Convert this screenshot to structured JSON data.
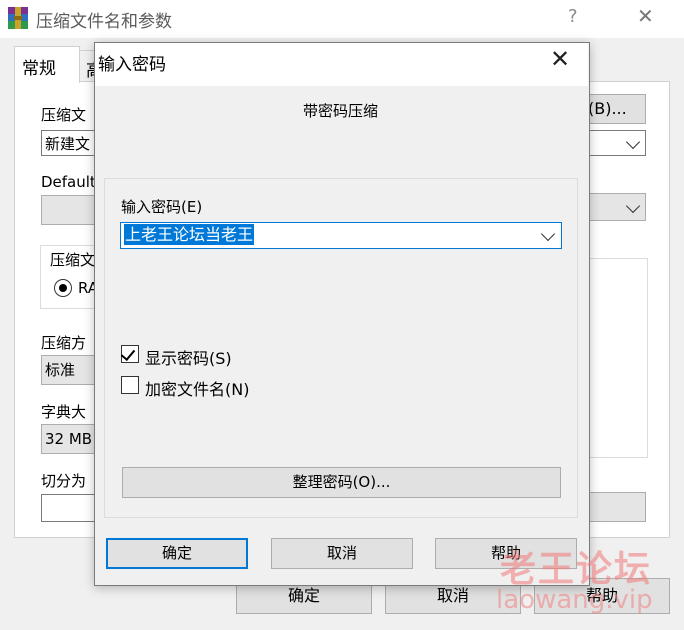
{
  "back_window": {
    "title": "压缩文件名和参数",
    "help_glyph": "?",
    "close_glyph": "✕",
    "tabs": [
      "常规",
      "高"
    ],
    "archive_name_label": "压缩文",
    "archive_name_value": "新建文",
    "browse_button": "(B)...",
    "default_label": "Default",
    "format_group_label": "压缩文",
    "format_radio_label": "RA",
    "method_label": "压缩方",
    "method_value": "标准",
    "dict_label": "字典大",
    "dict_value": "32 MB",
    "split_label": "切分为",
    "buttons": {
      "ok": "确定",
      "cancel": "取消",
      "help": "帮助"
    }
  },
  "dialog": {
    "title": "输入密码",
    "close_glyph": "✕",
    "heading": "带密码压缩",
    "password_label": "输入密码(E)",
    "password_value": "上老王论坛当老王",
    "show_password_label": "显示密码(S)",
    "show_password_checked": true,
    "encrypt_names_label": "加密文件名(N)",
    "encrypt_names_checked": false,
    "organize_button": "整理密码(O)...",
    "buttons": {
      "ok": "确定",
      "cancel": "取消",
      "help": "帮助"
    }
  },
  "watermark": {
    "line1": "老王论坛",
    "line2": "laowang.vip"
  },
  "colors": {
    "accent": "#0078d7",
    "dialog_bg": "#f0f0f0",
    "watermark": "#f07878"
  }
}
